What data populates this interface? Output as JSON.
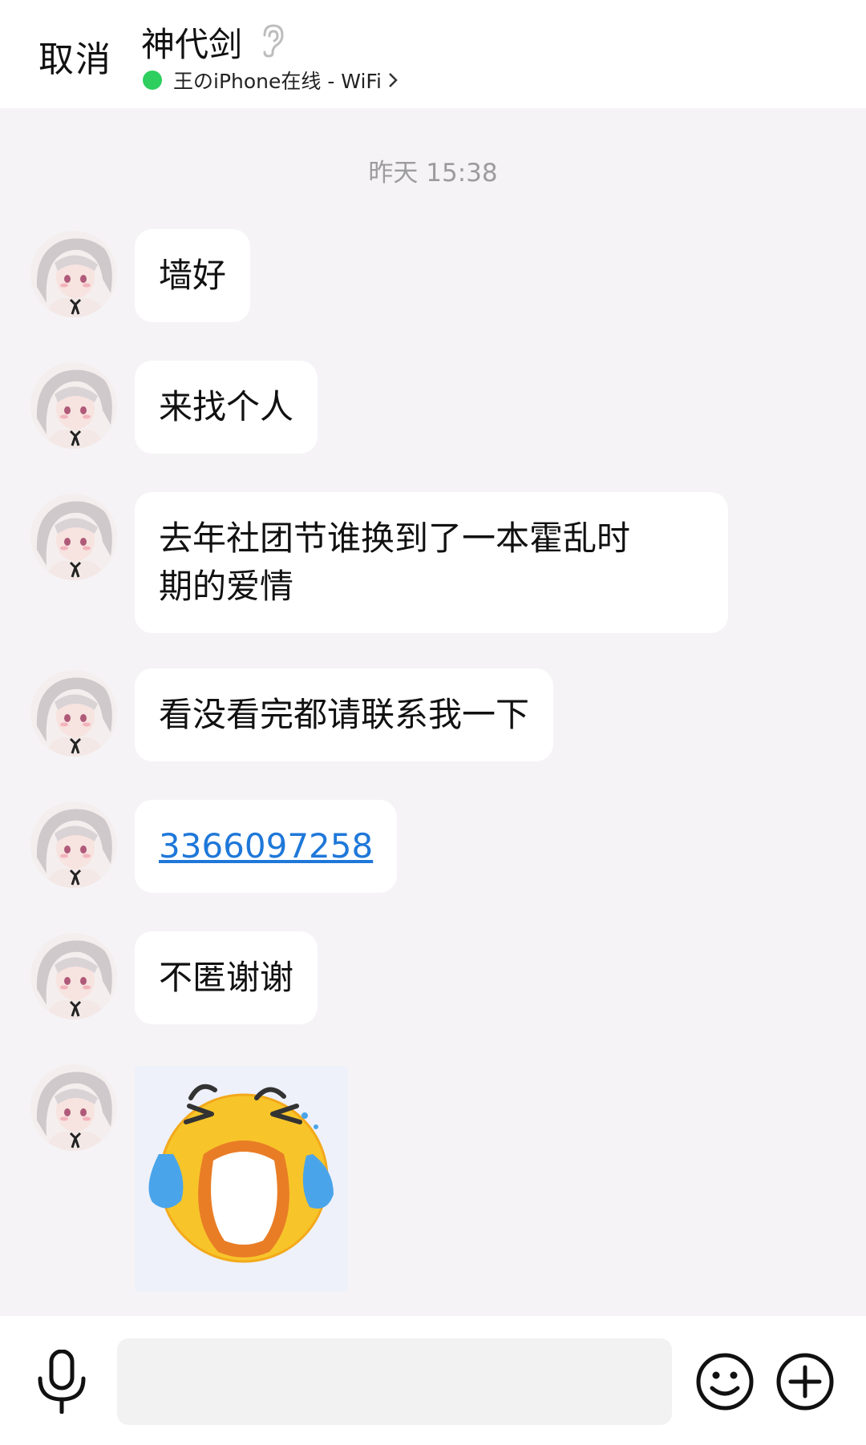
{
  "header": {
    "cancel_label": "取消",
    "contact_name": "神代剑",
    "status_text": "王のiPhone在线 - WiFi",
    "status_color": "#2ecf5e"
  },
  "chat": {
    "timestamp": "昨天 15:38",
    "messages": [
      {
        "type": "text",
        "text": "墙好"
      },
      {
        "type": "text",
        "text": "来找个人"
      },
      {
        "type": "text",
        "text": "去年社团节谁换到了一本霍乱时期的爱情",
        "display_lines": [
          "去年社团节谁换到了一本霍乱时",
          "期的爱情"
        ]
      },
      {
        "type": "text",
        "text": "看没看完都请联系我一下"
      },
      {
        "type": "link",
        "text": "3366097258"
      },
      {
        "type": "text",
        "text": "不匿谢谢"
      },
      {
        "type": "sticker",
        "icon": "crying-face-sticker"
      }
    ]
  },
  "colors": {
    "background": "#f5f3f6",
    "bubble": "#ffffff",
    "link": "#1f78d9",
    "time_text": "#9c9c9c"
  },
  "input_bar": {
    "placeholder": "",
    "icons": [
      "microphone-icon",
      "emoji-icon",
      "plus-icon"
    ]
  }
}
